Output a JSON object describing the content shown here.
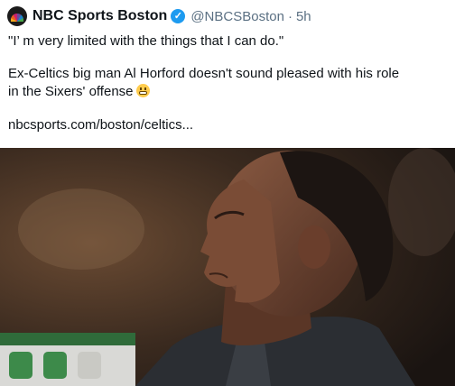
{
  "tweet": {
    "author_name": "NBC Sports Boston",
    "handle": "@NBCSBoston",
    "separator": "·",
    "time": "5h",
    "verified_mark": "✓",
    "quote_line": "\"I’  m very limited with the things that I can do.\"",
    "body_line_1": "Ex-Celtics big man Al Horford doesn't sound pleased with his role",
    "body_line_2": "in the Sixers' offense",
    "emoji": "grimacing-face",
    "link_text": "nbcsports.com/boston/celtics...",
    "media_icon": "photo-basketball-player-looking-up"
  },
  "colors": {
    "verified": "#1d9bf0",
    "secondary_text": "#5b7083",
    "primary_text": "#0f1419"
  }
}
